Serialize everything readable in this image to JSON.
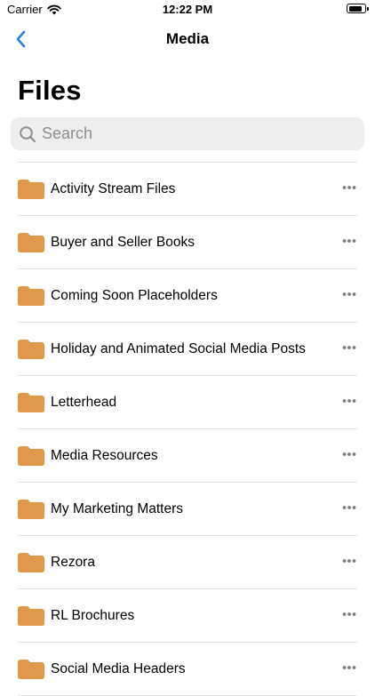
{
  "status_bar": {
    "carrier": "Carrier",
    "time": "12:22 PM",
    "battery_level": 0.9
  },
  "nav": {
    "title": "Media",
    "back_icon": "chevron-left-icon"
  },
  "header": {
    "large_title": "Files"
  },
  "search": {
    "placeholder": "Search",
    "icon": "search-icon"
  },
  "colors": {
    "folder": "#e0994a",
    "accent": "#2f7cf6",
    "separator": "#e2e2e4"
  },
  "folders": [
    {
      "label": "Activity Stream Files"
    },
    {
      "label": "Buyer and Seller Books"
    },
    {
      "label": "Coming Soon Placeholders"
    },
    {
      "label": "Holiday and Animated Social Media Posts"
    },
    {
      "label": "Letterhead"
    },
    {
      "label": "Media Resources"
    },
    {
      "label": "My Marketing Matters"
    },
    {
      "label": "Rezora"
    },
    {
      "label": "RL Brochures"
    },
    {
      "label": "Social Media Headers"
    }
  ]
}
